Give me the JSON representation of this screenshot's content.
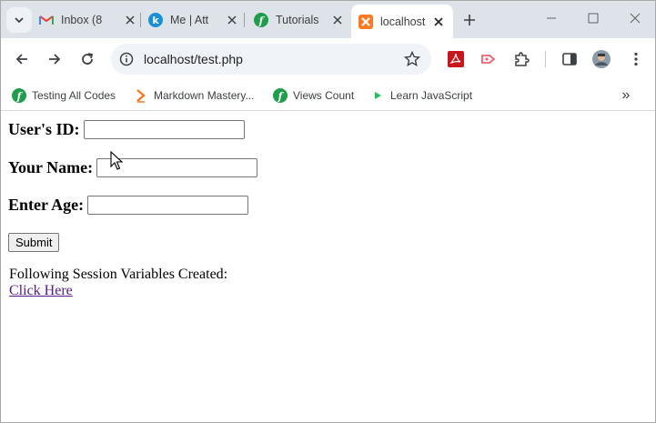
{
  "browser": {
    "tabs": [
      {
        "title": "Inbox (8",
        "favicon": "gmail-icon",
        "active": false
      },
      {
        "title": "Me | Att",
        "favicon": "k-icon",
        "active": false
      },
      {
        "title": "Tutorials",
        "favicon": "f-icon",
        "active": false
      },
      {
        "title": "localhost",
        "favicon": "xampp-icon",
        "active": true
      }
    ],
    "address": "localhost/test.php",
    "bookmarks": [
      {
        "label": "Testing All Codes",
        "icon": "f-icon"
      },
      {
        "label": "Markdown Mastery...",
        "icon": "markdown-chevron-icon"
      },
      {
        "label": "Views Count",
        "icon": "f-icon"
      },
      {
        "label": "Learn JavaScript",
        "icon": "play-icon"
      }
    ],
    "bookmarks_more": "»"
  },
  "form": {
    "user_id_label": "User's ID:",
    "user_id_value": "",
    "name_label": "Your Name:",
    "name_value": "",
    "age_label": "Enter Age:",
    "age_value": "",
    "submit_label": "Submit"
  },
  "session": {
    "message": "Following Session Variables Created:",
    "link_text": "Click Here"
  },
  "colors": {
    "tabstrip_bg": "#dee3ea",
    "link_visited": "#551a8b",
    "xampp_orange": "#fb7a24",
    "pdf_red": "#c8161d",
    "f_green": "#1e9e4a"
  }
}
